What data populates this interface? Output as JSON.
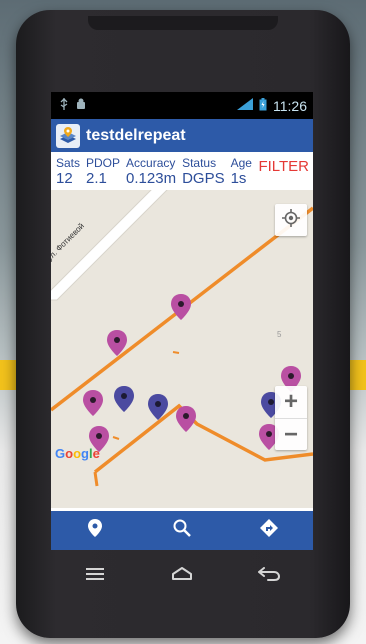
{
  "status_bar": {
    "time": "11:26",
    "icons": [
      "usb-icon",
      "android-debug-icon",
      "signal-icon",
      "battery-icon"
    ]
  },
  "app": {
    "title": "testdelrepeat",
    "logo_icon": "layers-pin-icon",
    "bar_color": "#2d5aa8"
  },
  "gps_info": {
    "columns": [
      {
        "label": "Sats",
        "value": "12"
      },
      {
        "label": "PDOP",
        "value": "2.1"
      },
      {
        "label": "Accuracy",
        "value": "0.123m"
      },
      {
        "label": "Status",
        "value": "DGPS"
      },
      {
        "label": "Age",
        "value": "1s"
      }
    ],
    "filter_label": "FILTER",
    "text_color": "#2d4e9a",
    "filter_color": "#e53935"
  },
  "map": {
    "street_label": "ул. Фотиевой",
    "attribution": [
      "G",
      "o",
      "o",
      "g",
      "l",
      "e"
    ],
    "scale_hint": "5",
    "zoom_in_label": "+",
    "zoom_out_label": "−",
    "route_color": "#ef8c2a",
    "marker_colors": {
      "pink": "#b94fa2",
      "purple": "#4b4aa0"
    }
  },
  "bottom_bar": {
    "buttons": [
      "location-pin-icon",
      "search-icon",
      "directions-icon"
    ]
  },
  "device_nav": {
    "buttons": [
      "menu-icon",
      "home-icon",
      "back-icon"
    ]
  }
}
